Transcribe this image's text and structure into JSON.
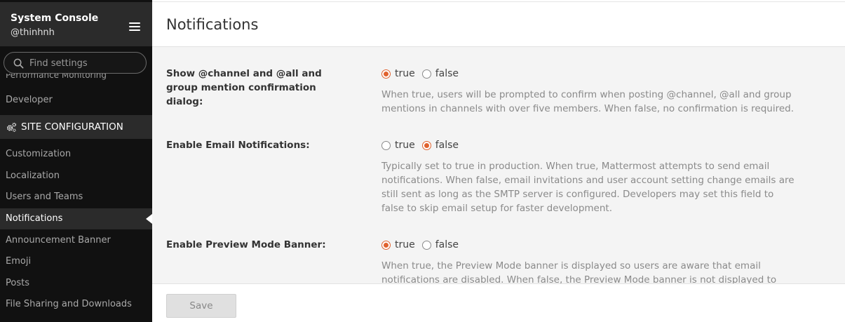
{
  "sidebar": {
    "title": "System Console",
    "username": "@thinhnh",
    "search_placeholder": "Find settings",
    "cut_item": "Performance Monitoring",
    "developer": "Developer",
    "section_title": "SITE CONFIGURATION",
    "items": [
      "Customization",
      "Localization",
      "Users and Teams",
      "Notifications",
      "Announcement Banner",
      "Emoji",
      "Posts",
      "File Sharing and Downloads"
    ]
  },
  "page": {
    "title": "Notifications"
  },
  "settings": [
    {
      "label": "Show @channel and @all and group mention confirmation dialog:",
      "true_label": "true",
      "false_label": "false",
      "selected": "true",
      "help": "When true, users will be prompted to confirm when posting @channel, @all and group mentions in channels with over five members. When false, no confirmation is required."
    },
    {
      "label": "Enable Email Notifications:",
      "true_label": "true",
      "false_label": "false",
      "selected": "false",
      "help": "Typically set to true in production. When true, Mattermost attempts to send email notifications. When false, email invitations and user account setting change emails are still sent as long as the SMTP server is configured. Developers may set this field to false to skip email setup for faster development."
    },
    {
      "label": "Enable Preview Mode Banner:",
      "true_label": "true",
      "false_label": "false",
      "selected": "true",
      "help": "When true, the Preview Mode banner is displayed so users are aware that email notifications are disabled. When false, the Preview Mode banner is not displayed to"
    }
  ],
  "footer": {
    "save_label": "Save"
  },
  "colors": {
    "accent": "#e0622e",
    "sidebar_bg": "#111111"
  }
}
